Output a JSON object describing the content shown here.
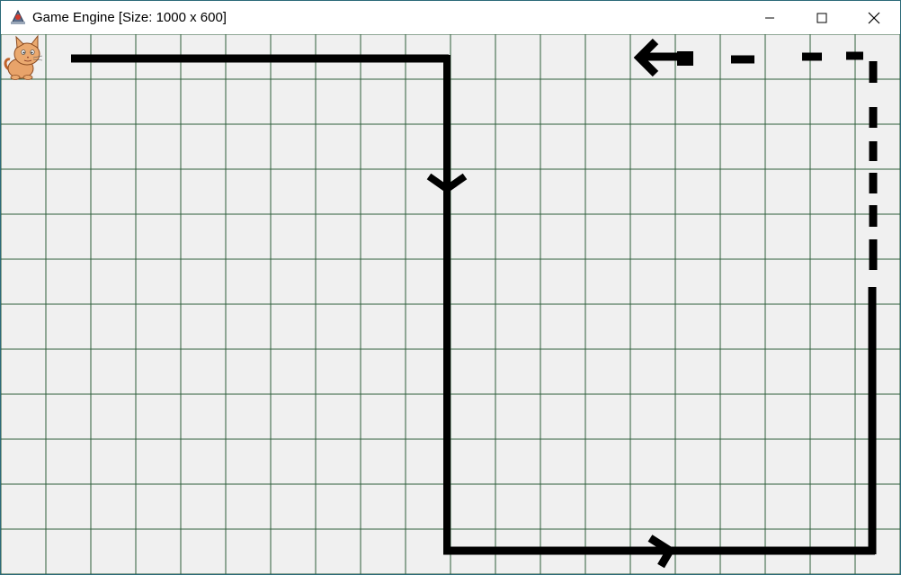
{
  "window": {
    "title": "Game Engine [Size: 1000 x 600]",
    "controls": {
      "minimize_icon": "minimize-icon",
      "maximize_icon": "maximize-icon",
      "close_icon": "close-icon"
    }
  },
  "game": {
    "grid_color": "#2e5e3a",
    "background_color": "#f0f0f0",
    "path_color": "#000000",
    "sprite": "cat-sprite"
  }
}
